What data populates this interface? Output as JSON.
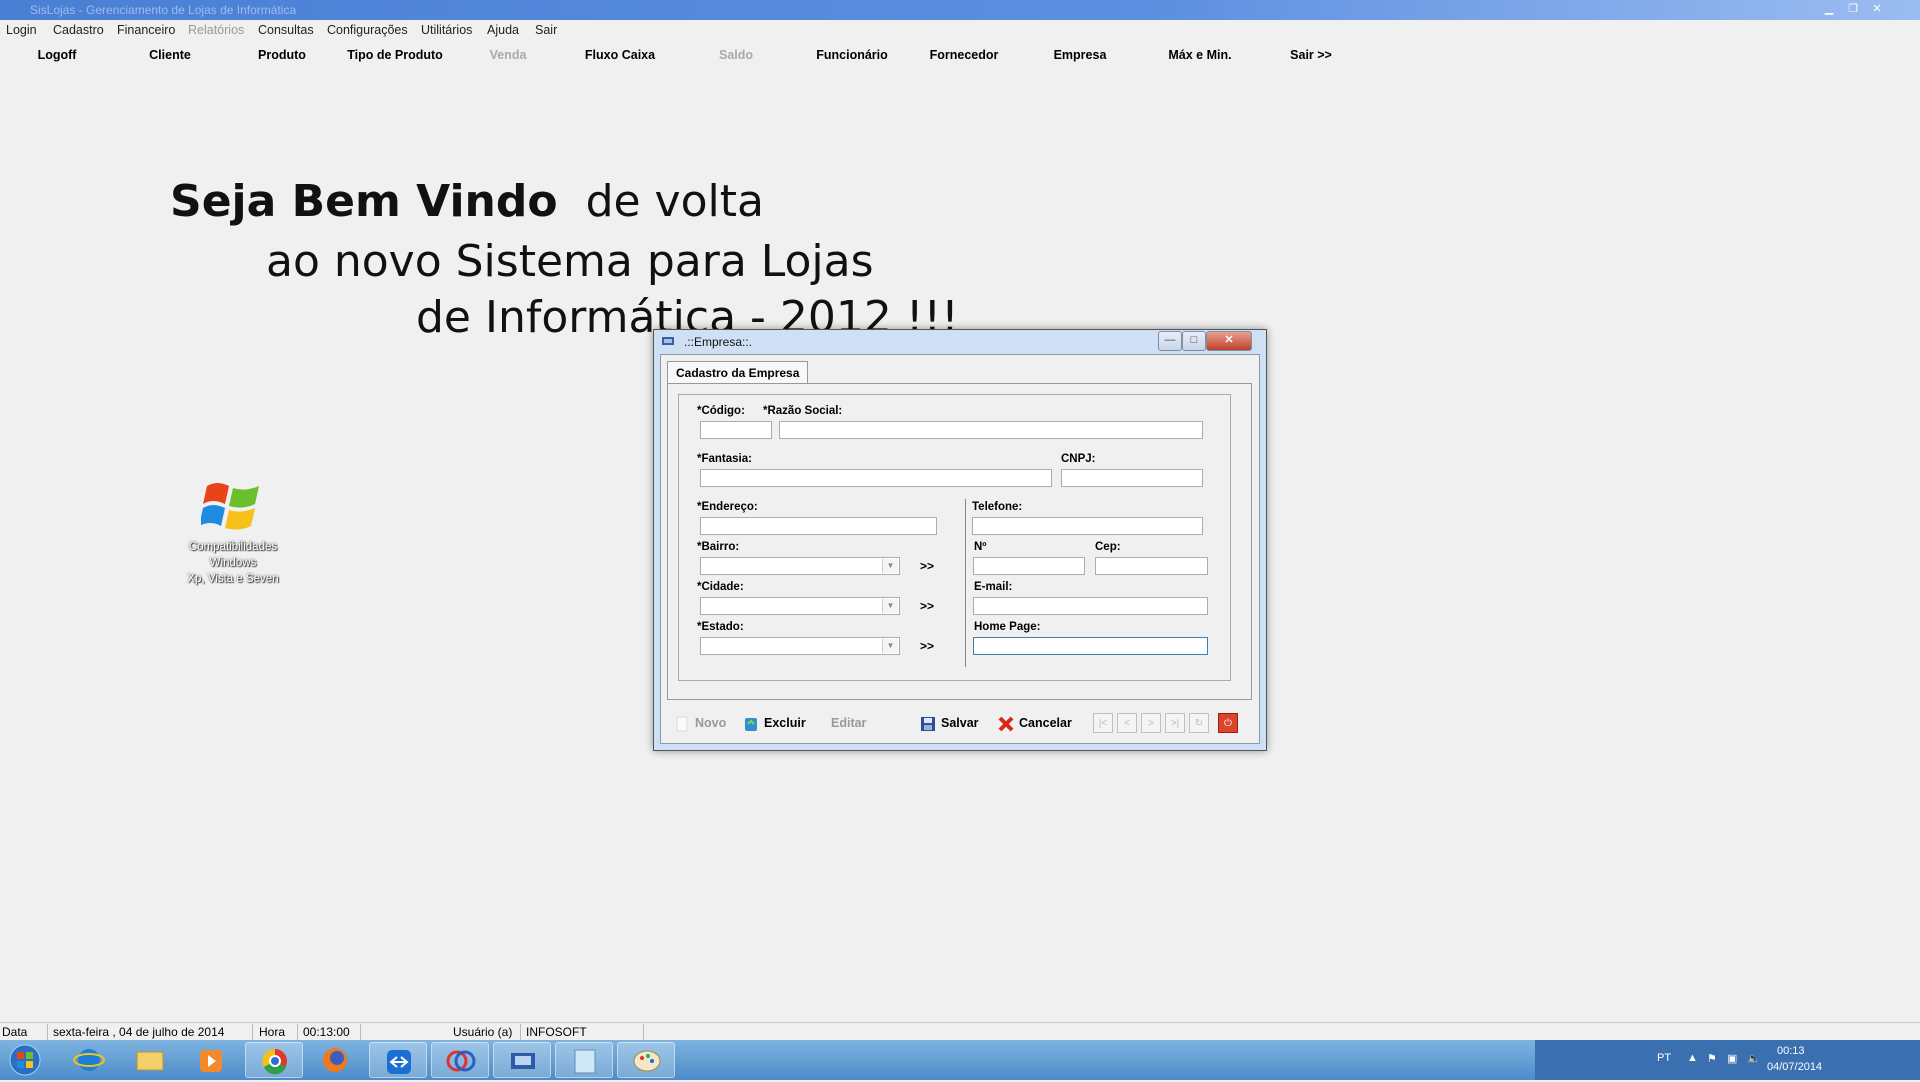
{
  "window": {
    "title": "SisLojas - Gerenciamento de Lojas de Informática"
  },
  "menu": [
    {
      "label": "Login",
      "enabled": true
    },
    {
      "label": "Cadastro",
      "enabled": true
    },
    {
      "label": "Financeiro",
      "enabled": true
    },
    {
      "label": "Relatórios",
      "enabled": false
    },
    {
      "label": "Consultas",
      "enabled": true
    },
    {
      "label": "Configurações",
      "enabled": true
    },
    {
      "label": "Utilitários",
      "enabled": true
    },
    {
      "label": "Ajuda",
      "enabled": true
    },
    {
      "label": "Sair",
      "enabled": true
    }
  ],
  "toolbar": [
    {
      "label": "Logoff",
      "enabled": true
    },
    {
      "label": "Cliente",
      "enabled": true
    },
    {
      "label": "Produto",
      "enabled": true
    },
    {
      "label": "Tipo de Produto",
      "enabled": true
    },
    {
      "label": "Venda",
      "enabled": false
    },
    {
      "label": "Fluxo Caixa",
      "enabled": true
    },
    {
      "label": "Saldo",
      "enabled": false
    },
    {
      "label": "Funcionário",
      "enabled": true
    },
    {
      "label": "Fornecedor",
      "enabled": true
    },
    {
      "label": "Empresa",
      "enabled": true
    },
    {
      "label": "Máx e Min.",
      "enabled": true
    },
    {
      "label": "Sair >>",
      "enabled": true
    }
  ],
  "welcome": {
    "bold": "Seja Bem Vindo",
    "line1_rest": "de volta",
    "line2": "ao novo Sistema para Lojas",
    "line3": "de Informática - 2012 !!!"
  },
  "desktop_icon": {
    "label_lines": [
      "Compatibilidades",
      "Windows",
      "Xp, Vista e Seven"
    ],
    "icon": "windows-logo-icon"
  },
  "dialog": {
    "title": ".::Empresa::.",
    "tab": "Cadastro da Empresa",
    "fields": {
      "codigo": {
        "label": "*Código:",
        "value": ""
      },
      "razao_social": {
        "label": "*Razão Social:",
        "value": ""
      },
      "fantasia": {
        "label": "*Fantasia:",
        "value": ""
      },
      "cnpj": {
        "label": "CNPJ:",
        "value": ""
      },
      "endereco": {
        "label": "*Endereço:",
        "value": ""
      },
      "telefone": {
        "label": "Telefone:",
        "value": ""
      },
      "bairro": {
        "label": "*Bairro:",
        "value": ""
      },
      "numero": {
        "label": "Nº",
        "value": ""
      },
      "cep": {
        "label": "Cep:",
        "value": ""
      },
      "cidade": {
        "label": "*Cidade:",
        "value": ""
      },
      "email": {
        "label": "E-mail:",
        "value": ""
      },
      "estado": {
        "label": "*Estado:",
        "value": ""
      },
      "home_page": {
        "label": "Home Page:",
        "value": ""
      }
    },
    "more_label": ">>",
    "buttons": {
      "novo": {
        "label": "Novo",
        "enabled": false
      },
      "excluir": {
        "label": "Excluir",
        "enabled": true
      },
      "editar": {
        "label": "Editar",
        "enabled": false
      },
      "salvar": {
        "label": "Salvar",
        "enabled": true
      },
      "cancelar": {
        "label": "Cancelar",
        "enabled": true
      }
    },
    "nav_icons": [
      "first-record-icon",
      "previous-record-icon",
      "next-record-icon",
      "last-record-icon",
      "refresh-icon"
    ],
    "window_controls": {
      "minimize": "—",
      "maximize": "□",
      "close": "✕"
    }
  },
  "statusbar": {
    "data_label": "Data",
    "data_value": "sexta-feira , 04  de  julho  de  2014",
    "hora_label": "Hora",
    "hora_value": "00:13:00",
    "usuario_label": "Usuário (a)",
    "usuario_value": "INFOSOFT"
  },
  "taskbar": {
    "items": [
      "start-orb-icon",
      "internet-explorer-icon",
      "file-explorer-icon",
      "media-player-icon",
      "chrome-icon",
      "firefox-icon",
      "teamviewer-icon",
      "app-icon",
      "delphi-icon",
      "notepad-icon",
      "paint-icon"
    ],
    "tray": {
      "lang": "PT",
      "time": "00:13",
      "date": "04/07/2014"
    }
  },
  "colors": {
    "accent": "#4a7fd4",
    "taskbar": "#5a96d0",
    "close_red": "#cc2a1a"
  }
}
